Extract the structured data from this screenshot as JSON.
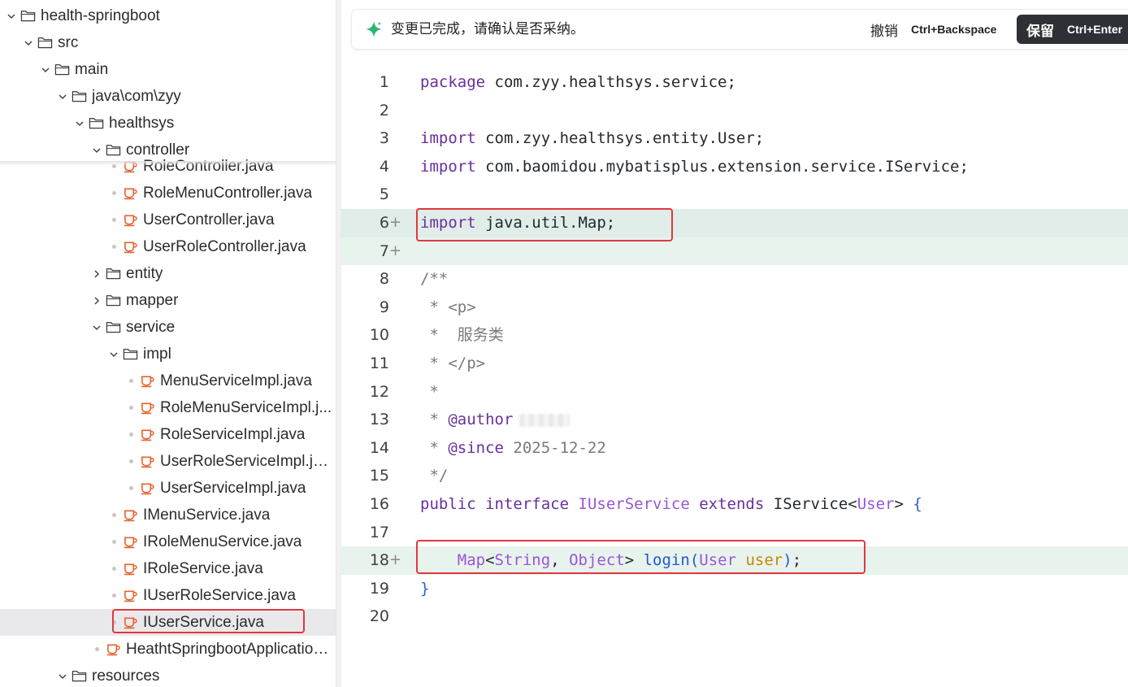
{
  "tree": [
    {
      "label": "health-springboot",
      "kind": "folder",
      "chevron": "down",
      "depth": 0
    },
    {
      "label": "src",
      "kind": "folder",
      "chevron": "down",
      "depth": 1
    },
    {
      "label": "main",
      "kind": "folder",
      "chevron": "down",
      "depth": 2
    },
    {
      "label": "java\\com\\zyy",
      "kind": "folder",
      "chevron": "down",
      "depth": 3
    },
    {
      "label": "healthsys",
      "kind": "folder",
      "chevron": "down",
      "depth": 4
    },
    {
      "label": "controller",
      "kind": "folder",
      "chevron": "down",
      "depth": 5
    },
    {
      "label": "RoleController.java",
      "kind": "java",
      "depth": 6
    },
    {
      "label": "RoleMenuController.java",
      "kind": "java",
      "depth": 6
    },
    {
      "label": "UserController.java",
      "kind": "java",
      "depth": 6
    },
    {
      "label": "UserRoleController.java",
      "kind": "java",
      "depth": 6
    },
    {
      "label": "entity",
      "kind": "folder",
      "chevron": "right",
      "depth": 5
    },
    {
      "label": "mapper",
      "kind": "folder",
      "chevron": "right",
      "depth": 5
    },
    {
      "label": "service",
      "kind": "folder",
      "chevron": "down",
      "depth": 5
    },
    {
      "label": "impl",
      "kind": "folder",
      "chevron": "down",
      "depth": 6
    },
    {
      "label": "MenuServiceImpl.java",
      "kind": "java",
      "depth": 7
    },
    {
      "label": "RoleMenuServiceImpl.j...",
      "kind": "java",
      "depth": 7
    },
    {
      "label": "RoleServiceImpl.java",
      "kind": "java",
      "depth": 7
    },
    {
      "label": "UserRoleServiceImpl.java",
      "kind": "java",
      "depth": 7
    },
    {
      "label": "UserServiceImpl.java",
      "kind": "java",
      "depth": 7
    },
    {
      "label": "IMenuService.java",
      "kind": "java",
      "depth": 6
    },
    {
      "label": "IRoleMenuService.java",
      "kind": "java",
      "depth": 6
    },
    {
      "label": "IRoleService.java",
      "kind": "java",
      "depth": 6
    },
    {
      "label": "IUserRoleService.java",
      "kind": "java",
      "depth": 6
    },
    {
      "label": "IUserService.java",
      "kind": "java",
      "depth": 6,
      "selected": true
    },
    {
      "label": "HeathtSpringbootApplication.j...",
      "kind": "java",
      "depth": 5
    },
    {
      "label": "resources",
      "kind": "folder",
      "chevron": "down",
      "depth": 3
    }
  ],
  "diff_bar": {
    "message": "变更已完成，请确认是否采纳。",
    "undo_label": "撤销",
    "undo_shortcut": "Ctrl+Backspace",
    "keep_label": "保留",
    "keep_shortcut": "Ctrl+Enter",
    "icon": "sparkle-icon"
  },
  "editor": {
    "lines": [
      {
        "n": "1",
        "code": "package com.zyy.healthsys.service;"
      },
      {
        "n": "2",
        "code": ""
      },
      {
        "n": "3",
        "code": "import com.zyy.healthsys.entity.User;"
      },
      {
        "n": "4",
        "code": "import com.baomidou.mybatisplus.extension.service.IService;"
      },
      {
        "n": "5",
        "code": ""
      },
      {
        "n": "6",
        "code": "import java.util.Map;",
        "added": true
      },
      {
        "n": "7",
        "code": "",
        "added": true
      },
      {
        "n": "8",
        "code": "/**"
      },
      {
        "n": "9",
        "code": " * <p>"
      },
      {
        "n": "10",
        "code": " *  服务类"
      },
      {
        "n": "11",
        "code": " * </p>"
      },
      {
        "n": "12",
        "code": " *"
      },
      {
        "n": "13",
        "code": " * @author"
      },
      {
        "n": "14",
        "code": " * @since 2025-12-22"
      },
      {
        "n": "15",
        "code": " */"
      },
      {
        "n": "16",
        "code": "public interface IUserService extends IService<User> {"
      },
      {
        "n": "17",
        "code": ""
      },
      {
        "n": "18",
        "code": "    Map<String, Object> login(User user);",
        "added": true
      },
      {
        "n": "19",
        "code": "}"
      },
      {
        "n": "20",
        "code": ""
      }
    ],
    "added_marker": "+"
  },
  "colors": {
    "highlight_box": "#e0383e",
    "added_line_bg": "#e8f3ee",
    "java_icon": "#e8622c",
    "keep_button_bg": "#2f3035",
    "spark": "#2bb673"
  }
}
